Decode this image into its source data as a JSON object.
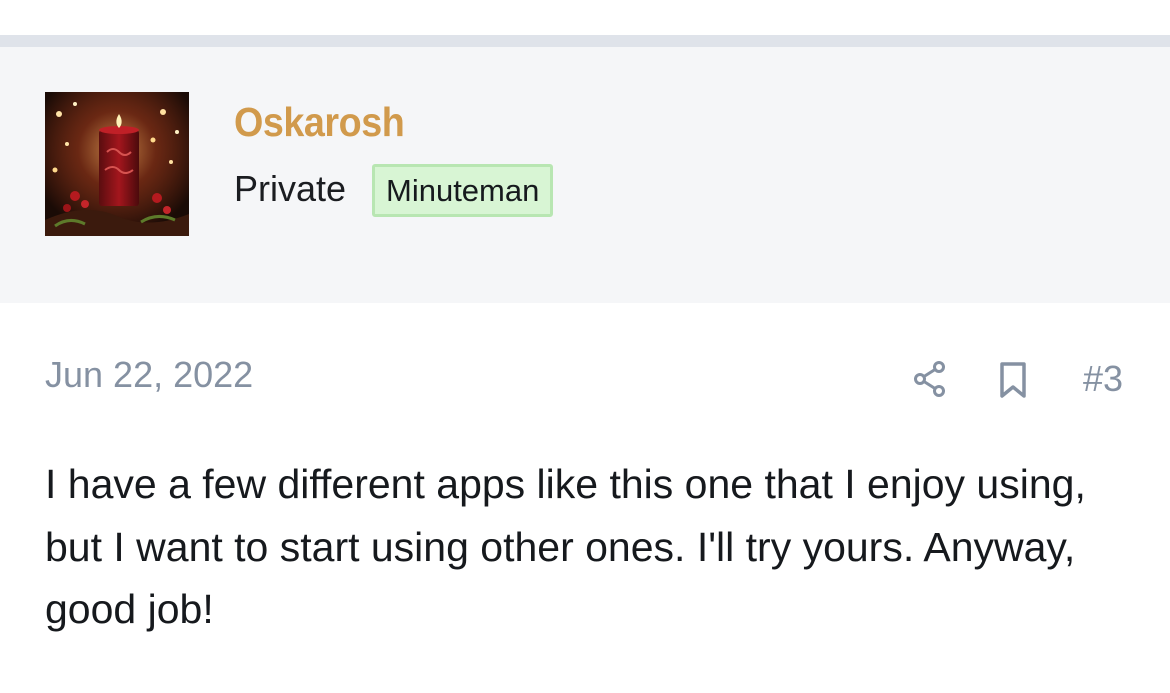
{
  "author": {
    "username": "Oskarosh",
    "title": "Private",
    "rank_badge": "Minuteman",
    "avatar_icon": "candle-avatar-image"
  },
  "post": {
    "date": "Jun 22, 2022",
    "number": "#3",
    "body": "I have a few different apps like this one that I enjoy using, but I want to start using other ones. I'll try yours. Anyway, good job!",
    "actions": {
      "share_icon": "share-icon",
      "bookmark_icon": "bookmark-icon"
    }
  },
  "colors": {
    "username": "#d19a4c",
    "header_background": "#f5f6f8",
    "divider": "#dfe3ea",
    "badge_background": "#d8f5d4",
    "badge_border": "#b8e6b2",
    "muted_text": "#8591a2",
    "body_text": "#16191d"
  }
}
